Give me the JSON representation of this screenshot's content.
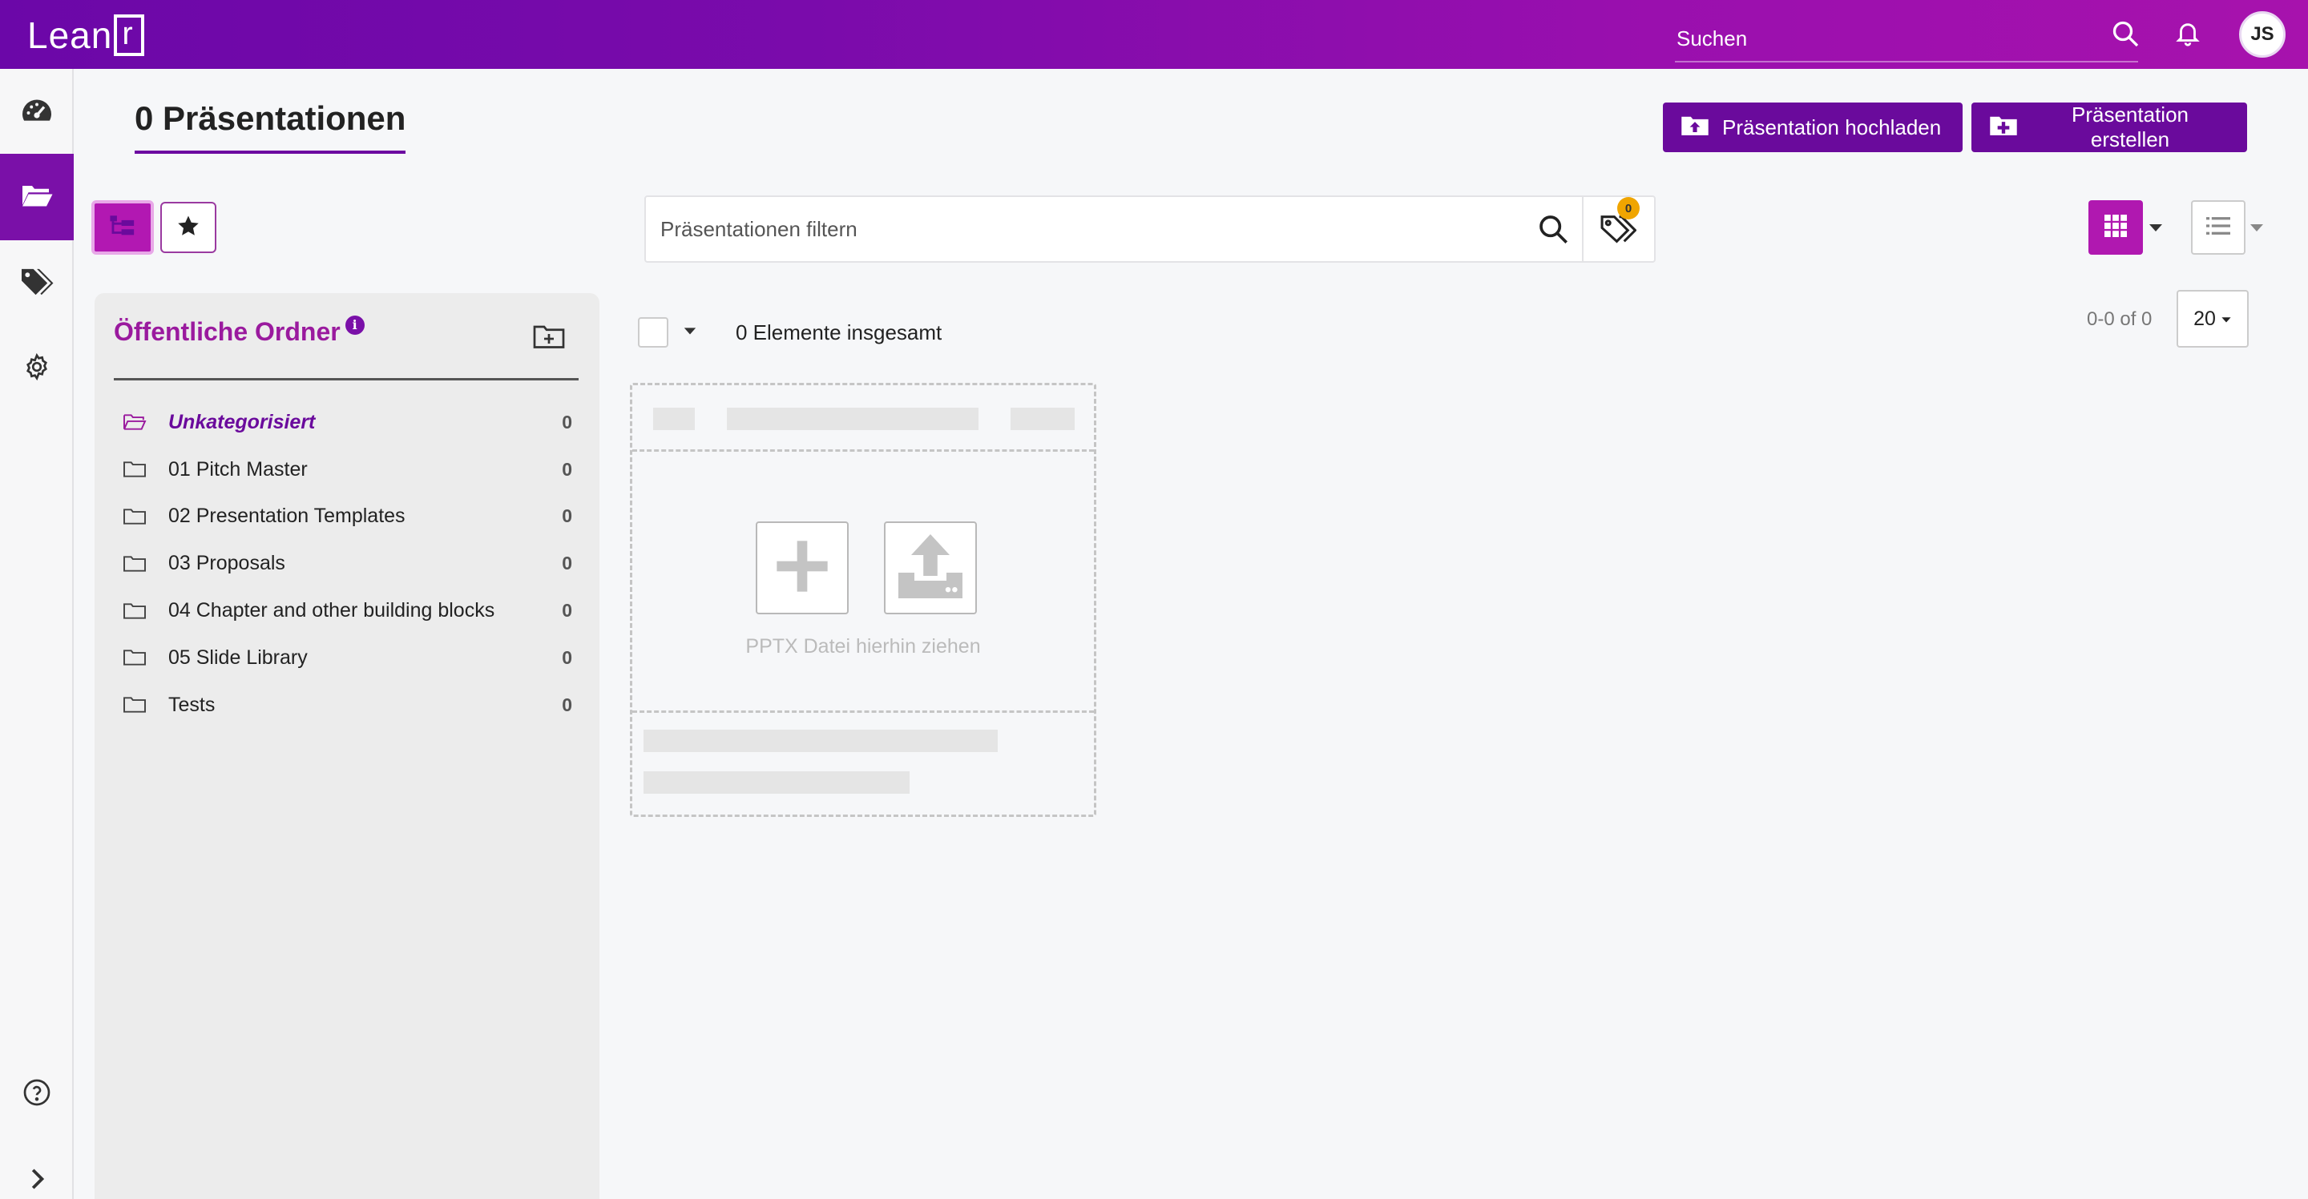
{
  "app": {
    "logo_text": "Lean",
    "logo_box_letter": "r"
  },
  "topbar": {
    "search_placeholder": "Suchen",
    "avatar_initials": "JS"
  },
  "leftnav": {
    "items": [
      {
        "name": "dashboard",
        "icon": "speedometer-icon",
        "active": false
      },
      {
        "name": "presentations",
        "icon": "folder-open-icon",
        "active": true
      },
      {
        "name": "tags",
        "icon": "tags-icon",
        "active": false
      },
      {
        "name": "settings",
        "icon": "gear-icon",
        "active": false
      }
    ],
    "bottom": [
      {
        "name": "help",
        "icon": "question-circle-icon"
      },
      {
        "name": "expand",
        "icon": "chevron-right-icon"
      }
    ]
  },
  "header": {
    "title": "0 Präsentationen",
    "upload_label": "Präsentation hochladen",
    "create_label": "Präsentation erstellen"
  },
  "filter": {
    "placeholder": "Präsentationen filtern",
    "tag_badge_count": "0"
  },
  "folders": {
    "title": "Öffentliche Ordner",
    "info_glyph": "i",
    "items": [
      {
        "label": "Unkategorisiert",
        "count": "0",
        "active": true
      },
      {
        "label": "01 Pitch Master",
        "count": "0",
        "active": false
      },
      {
        "label": "02 Presentation Templates",
        "count": "0",
        "active": false
      },
      {
        "label": "03 Proposals",
        "count": "0",
        "active": false
      },
      {
        "label": "04 Chapter and other building blocks",
        "count": "0",
        "active": false
      },
      {
        "label": "05 Slide Library",
        "count": "0",
        "active": false
      },
      {
        "label": "Tests",
        "count": "0",
        "active": false
      }
    ]
  },
  "results": {
    "total_text": "0 Elemente insgesamt",
    "pager_text": "0-0 of 0",
    "page_size": "20"
  },
  "dropzone": {
    "hint": "PPTX Datei hierhin ziehen"
  },
  "colors": {
    "brand_purple": "#6a0a9c",
    "accent_magenta": "#b018b0",
    "badge_orange": "#f0a500"
  }
}
